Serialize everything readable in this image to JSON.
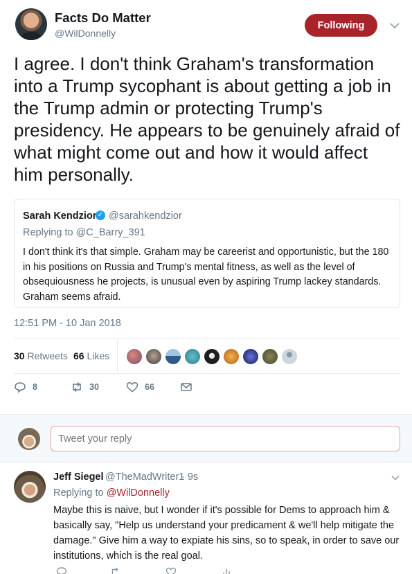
{
  "tweet": {
    "display_name": "Facts Do Matter",
    "handle": "@WilDonnelly",
    "follow_label": "Following",
    "text": "I agree. I don't think Graham's transformation into a Trump sycophant is about getting a job in the Trump admin or protecting Trump's presidency. He appears to be genuinely afraid of what might come out and how it would affect him personally.",
    "timestamp": "12:51 PM - 10 Jan 2018",
    "accent_color": "#a8242b"
  },
  "quote": {
    "name": "Sarah Kendzior",
    "handle": "@sarahkendzior",
    "replying_to": "Replying to @C_Barry_391",
    "text": "I don't think it's that simple. Graham may be careerist and opportunistic, but the 180 in his positions on Russia and Trump's mental fitness, as well as the level of obsequiousness he projects, is unusual even by aspiring Trump lackey standards. Graham seems afraid."
  },
  "stats": {
    "retweets_count": "30",
    "retweets_label": "Retweets",
    "likes_count": "66",
    "likes_label": "Likes"
  },
  "actions": {
    "reply_count": "8",
    "retweet_count": "30",
    "like_count": "66"
  },
  "reply_box": {
    "placeholder": "Tweet your reply"
  },
  "reply": {
    "name": "Jeff Siegel",
    "handle": "@TheMadWriter1",
    "time": "· 9s",
    "replying_prefix": "Replying to ",
    "replying_to": "@WilDonnelly",
    "text": "Maybe this is naive, but I wonder if it's possible for Dems to approach him & basically say, \"Help us understand your predicament & we'll help mitigate the damage.\" Give him a way to expiate his sins, so to speak, in order to save our institutions, which is the real goal."
  }
}
